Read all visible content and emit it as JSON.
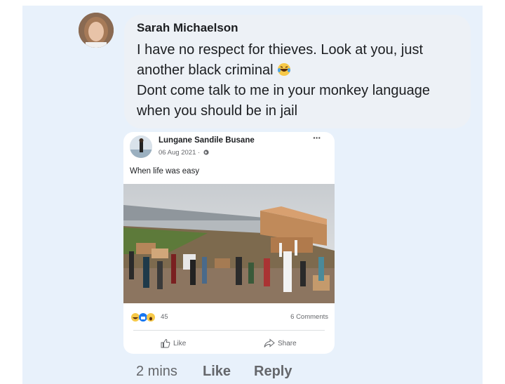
{
  "comment": {
    "author": "Sarah Michaelson",
    "lines": [
      "I have no respect for thieves. Look at you, just",
      "another black criminal",
      "Dont come talk to me in your monkey language",
      "when you should be in jail"
    ],
    "emoji": "laughing-crying-emoji"
  },
  "post": {
    "author": "Lungane Sandile Busane",
    "date": "06 Aug 2021 · ",
    "privacy_icon": "globe-icon",
    "text": "When life was easy",
    "reaction_count": "45",
    "comments": "6 Comments",
    "like_label": "Like",
    "share_label": "Share"
  },
  "meta": {
    "time": "2 mins",
    "like": "Like",
    "reply": "Reply"
  },
  "colors": {
    "panel_bg": "#e8f1fb",
    "bubble_bg": "#edf1f6",
    "text": "#1c1e21",
    "secondary": "#65676b"
  }
}
